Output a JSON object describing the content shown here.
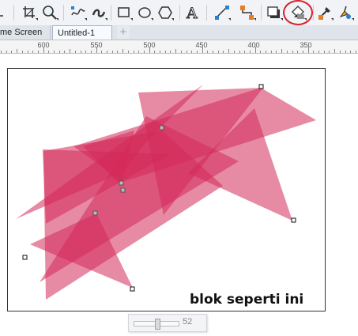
{
  "toolbar": {
    "tools": [
      {
        "name": "crop-icon"
      },
      {
        "name": "zoom-icon"
      },
      {
        "name": "freehand-icon"
      },
      {
        "name": "artistic-media-icon"
      },
      {
        "name": "rectangle-icon"
      },
      {
        "name": "ellipse-icon"
      },
      {
        "name": "polygon-icon"
      },
      {
        "name": "text-icon",
        "glyph": "A"
      },
      {
        "name": "parallel-dimension-icon"
      },
      {
        "name": "connector-icon"
      },
      {
        "name": "drop-shadow-icon"
      },
      {
        "name": "transparency-icon"
      },
      {
        "name": "eyedropper-icon"
      },
      {
        "name": "interactive-fill-icon"
      },
      {
        "name": "smart-fill-icon"
      }
    ],
    "highlight_color": "#d9202a"
  },
  "tabs": {
    "inactive_label": "me Screen",
    "active_label": "Untitled-1",
    "add_label": "+"
  },
  "ruler": {
    "labels": [
      "600",
      "550",
      "500",
      "450",
      "400",
      "350"
    ]
  },
  "canvas": {
    "caption": "blok seperti ini",
    "shape_color": "#d42a5a"
  },
  "scroll_widget": {
    "value": "52"
  }
}
